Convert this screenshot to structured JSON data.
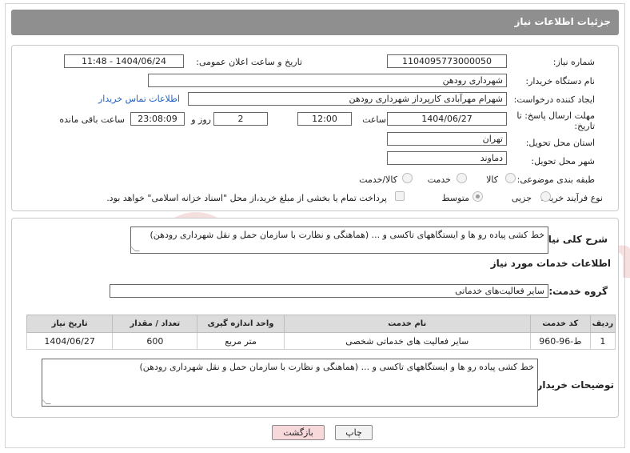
{
  "header": {
    "title": "جزئیات اطلاعات نیاز"
  },
  "need": {
    "number_label": "شماره نیاز:",
    "number": "1104095773000050",
    "announce_label": "تاریخ و ساعت اعلان عمومی:",
    "announce_value": "1404/06/24 - 11:48",
    "buyer_org_label": "نام دستگاه خریدار:",
    "buyer_org": "شهرداری رودهن",
    "requester_label": "ایجاد کننده درخواست:",
    "requester": "شهرام مهرآبادی کارپرداز شهرداری رودهن",
    "contact_link": "اطلاعات تماس خریدار",
    "deadline_label_1": "مهلت ارسال پاسخ: تا",
    "deadline_label_2": "تاریخ:",
    "deadline_date": "1404/06/27",
    "time_label": "ساعت",
    "deadline_time": "12:00",
    "days_value": "2",
    "days_label": "روز و",
    "remaining_time": "23:08:09",
    "remaining_label": "ساعت باقی مانده",
    "province_label": "استان محل تحویل:",
    "province": "تهران",
    "city_label": "شهر محل تحویل:",
    "city": "دماوند",
    "category_label": "طبقه بندی موضوعی:",
    "category_options": [
      "کالا",
      "خدمت",
      "کالا/خدمت"
    ],
    "process_label": "نوع فرآیند خرید :",
    "process_options": [
      "جزیی",
      "متوسط"
    ],
    "payment_note": "پرداخت تمام یا بخشی از مبلغ خرید،از محل \"اسناد خزانه اسلامی\" خواهد بود."
  },
  "description": {
    "label": "شرح کلی نیاز:",
    "text": "خط کشی پیاده رو ها و ایستگاههای تاکسی و ... (هماهنگی و نظارت با سازمان حمل و نقل شهرداری رودهن)"
  },
  "services": {
    "section_title": "اطلاعات خدمات مورد نیاز",
    "group_label": "گروه خدمت:",
    "group_value": "سایر فعالیت‌های خدماتی",
    "columns": [
      "ردیف",
      "کد خدمت",
      "نام خدمت",
      "واحد اندازه گیری",
      "تعداد / مقدار",
      "تاریخ نیاز"
    ],
    "rows": [
      [
        "1",
        "ط-96-960",
        "سایر فعالیت های خدماتی شخصی",
        "متر مربع",
        "600",
        "1404/06/27"
      ]
    ]
  },
  "buyer_notes": {
    "label": "توضیحات خریدار:",
    "text": "خط کشی پیاده رو ها و ایستگاههای تاکسی و ... (هماهنگی و نظارت با سازمان حمل و نقل شهرداری رودهن)"
  },
  "buttons": {
    "print": "چاپ",
    "back": "بازگشت"
  },
  "watermark": {
    "text": "AriaTender.neT"
  },
  "colors": {
    "header_bg": "#8f8f8f",
    "link": "#1f5fbf",
    "back_button_bg": "#f7d9dc"
  }
}
